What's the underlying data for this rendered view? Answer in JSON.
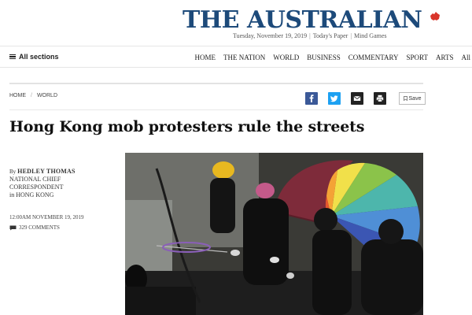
{
  "masthead": {
    "logo_text": "THE AUSTRALIAN",
    "date": "Tuesday, November 19, 2019",
    "todays_paper": "Today's Paper",
    "mind_games": "Mind Games",
    "brand_color": "#1d4a7a",
    "accent_color": "#d9352b"
  },
  "nav": {
    "all_sections": "All sections",
    "links": [
      "HOME",
      "THE NATION",
      "WORLD",
      "BUSINESS",
      "COMMENTARY",
      "SPORT",
      "ARTS",
      "All"
    ]
  },
  "breadcrumb": [
    "HOME",
    "WORLD"
  ],
  "share": {
    "icons": [
      "facebook-icon",
      "twitter-icon",
      "email-icon",
      "print-icon"
    ],
    "save_label": "Save",
    "colors": {
      "facebook": "#3b5998",
      "twitter": "#1da1f2",
      "email": "#222222",
      "print": "#222222"
    }
  },
  "article": {
    "headline": "Hong Kong mob protesters rule the streets",
    "by": "By",
    "author": "HEDLEY THOMAS",
    "role_line1": "NATIONAL CHIEF",
    "role_line2": "CORRESPONDENT",
    "location": "in HONG KONG",
    "timestamp": "12:00AM NOVEMBER 19, 2019",
    "comments": "329 COMMENTS"
  }
}
